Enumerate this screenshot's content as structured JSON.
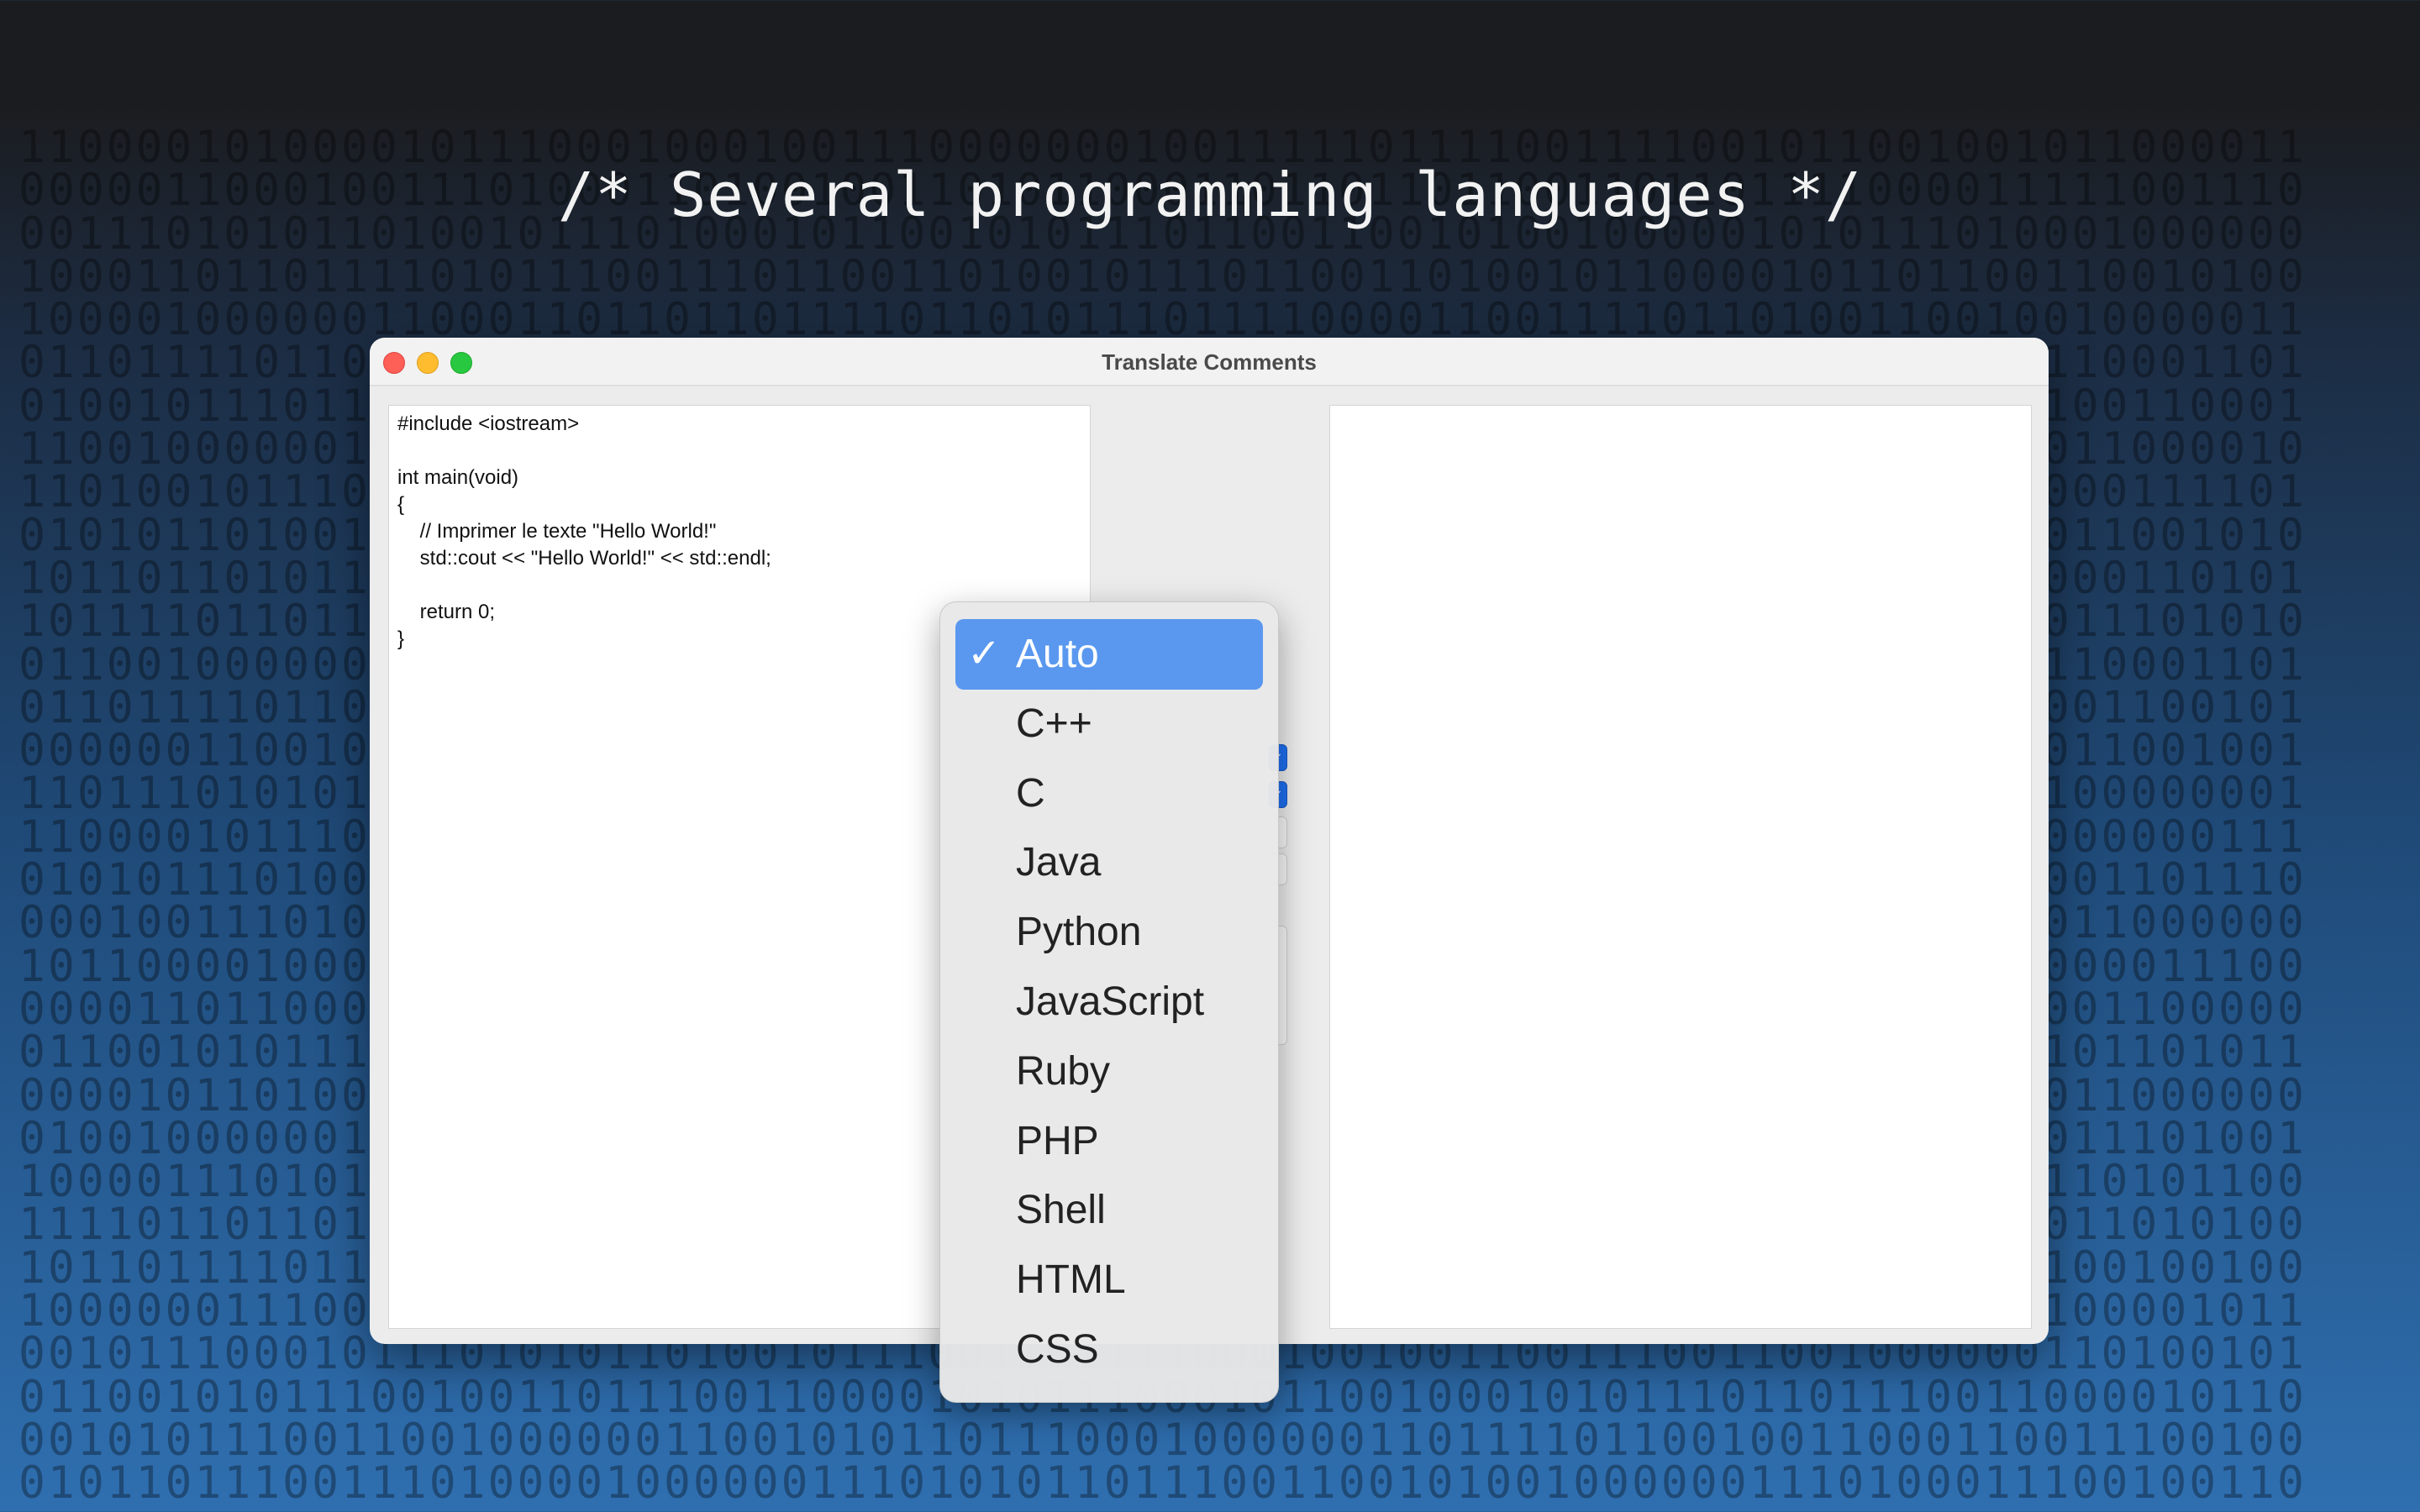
{
  "headline": "/* Several programming languages */",
  "window": {
    "title": "Translate Comments"
  },
  "source_code": [
    "#include <iostream>",
    "",
    "int main(void)",
    "{",
    "    // Imprimer le texte \"Hello World!\"",
    "    std::cout << \"Hello World!\" << std::endl;",
    "",
    "    return 0;",
    "}"
  ],
  "language_menu": {
    "selected": "Auto",
    "check_glyph": "✓",
    "items": [
      "Auto",
      "C++",
      "C",
      "Java",
      "Python",
      "JavaScript",
      "Ruby",
      "PHP",
      "Shell",
      "HTML",
      "CSS"
    ]
  },
  "background_binary": [
    "110000101000010111000100010011100000001001111101111001111001011001001011000011",
    "000001100010011101000110100100110101100011011011011001101101111000011111001110",
    "001110101011010010111010001011001010111011001100101001000001010111010001000000",
    "100011011011110101110011101100110100101110110011010010110000101101100110010100",
    "100001000000110001101101101111011010111011110000110011110110100110010010000011",
    "011011110110111011000101001011100100111100101101000100101100010111000110001101",
    "010010111011110101100011101001110101001011110011000111010011000011001100110001",
    "110010000001101000110110111011000101111000101101110111001101000011000011000010",
    "110100101110100110101001101000011011011110010101101011010010000011001000111101",
    "010101101001010010111000011110101101101111110000001101000110111010100011001010",
    "101101101011000111111101101101100001110111100101110110110101110000011000110101",
    "101111011011100100101111001100001001101001001100110110101000011100101011101010",
    "011001000000010110100001100100010101110010100101101001010001001000000110001101",
    "011011110110101110101001011111010011110110000000000000001110101011010001100101",
    "000000110010110101011101111011110101000000110000011111010111000101110011001001",
    "110111010101111100011011011101011011111110100001101110110010000110100100000001",
    "110000101110101011011001101010011110110111011100001111101100010101001000000111",
    "010101110100011010110111111010010101101011010011010010001001011010000001101110",
    "000100111010010111001010001011100001111000100110010111100001101000110011000000",
    "101100001000000101101001111010110101111101010111100110101010110101110000011100",
    "000011011000011111001110111010110101101101111010001111101001010010000001100000",
    "011001010111111010101101111000101101111011101010100001011010110100110101101011",
    "000010110100010010100000000011100111111100010010011110100111000101100011000000",
    "010010000001010111101101110110011101110011001100111001101101011101001011101001",
    "100001110101010101010001111110001000000111101011010110111100101010100110101100",
    "111101101101010111101001000011010110100111000011110001011010110101111011010100",
    "101101111011100110100000111111001110000101100110000001100110100101001100100100",
    "100000011100010000110111011101101101100100001100001011101100111101110100001011",
    "001011100010111010101101001011100110111100010010011001110011001000000110100101",
    "011001010111001001101110011000010101110001011001000101011101101110011000010110",
    "001010111001100100000011001010110111000100000011011110110010011000110011100100",
    "010110111001110100001000000111010101101110011001010010000001110100011100100110"
  ]
}
